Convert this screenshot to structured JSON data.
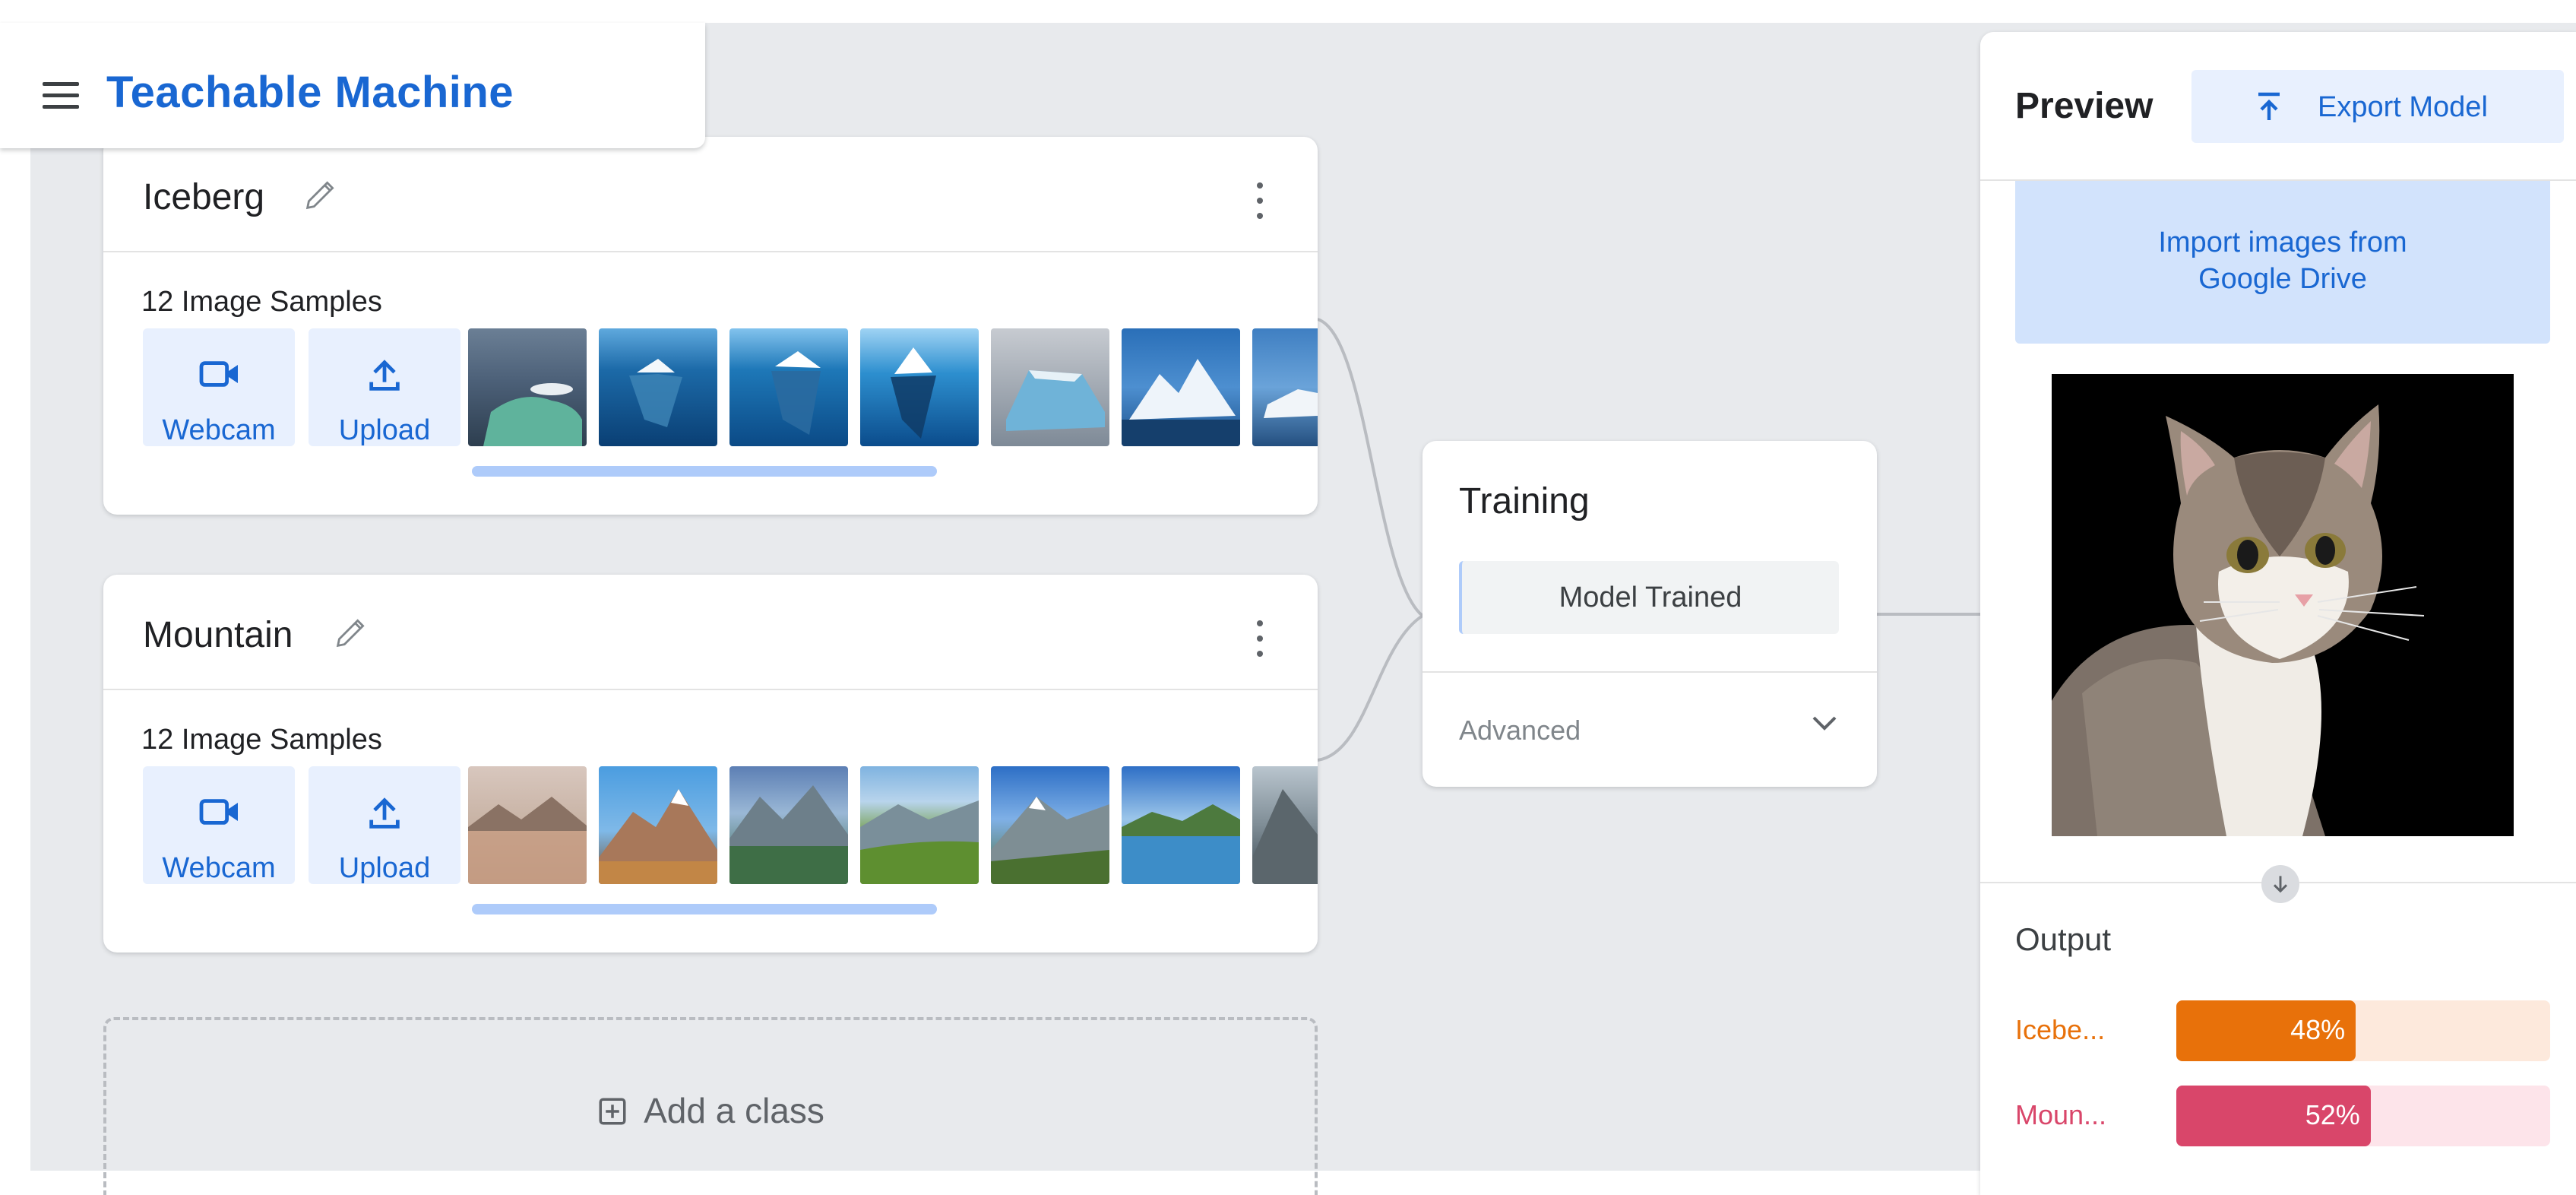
{
  "app": {
    "title": "Teachable Machine"
  },
  "classes": [
    {
      "name": "Iceberg",
      "samples_label": "12 Image Samples",
      "webcam_label": "Webcam",
      "upload_label": "Upload",
      "thumbnails": [
        "iceberg-1",
        "iceberg-2",
        "iceberg-3",
        "iceberg-4",
        "iceberg-5",
        "iceberg-6",
        "iceberg-7"
      ]
    },
    {
      "name": "Mountain",
      "samples_label": "12 Image Samples",
      "webcam_label": "Webcam",
      "upload_label": "Upload",
      "thumbnails": [
        "mountain-1",
        "mountain-2",
        "mountain-3",
        "mountain-4",
        "mountain-5",
        "mountain-6",
        "mountain-7"
      ]
    }
  ],
  "add_class": {
    "label": "Add a class"
  },
  "training": {
    "title": "Training",
    "button_label": "Model Trained",
    "advanced_label": "Advanced"
  },
  "preview": {
    "title": "Preview",
    "export_label": "Export Model",
    "drive_line1": "Import images from",
    "drive_line2": "Google Drive",
    "output_label": "Output",
    "outputs": [
      {
        "label": "Icebe...",
        "percent_label": "48%",
        "value": 0.48,
        "color": "#e8710a",
        "track_color": "#fde9dc"
      },
      {
        "label": "Moun...",
        "percent_label": "52%",
        "value": 0.52,
        "color": "#d9466a",
        "track_color": "#fde4ea"
      }
    ]
  },
  "colors": {
    "accent": "#1967d2",
    "accent_light": "#e8f0fe",
    "canvas": "#e8eaed"
  }
}
